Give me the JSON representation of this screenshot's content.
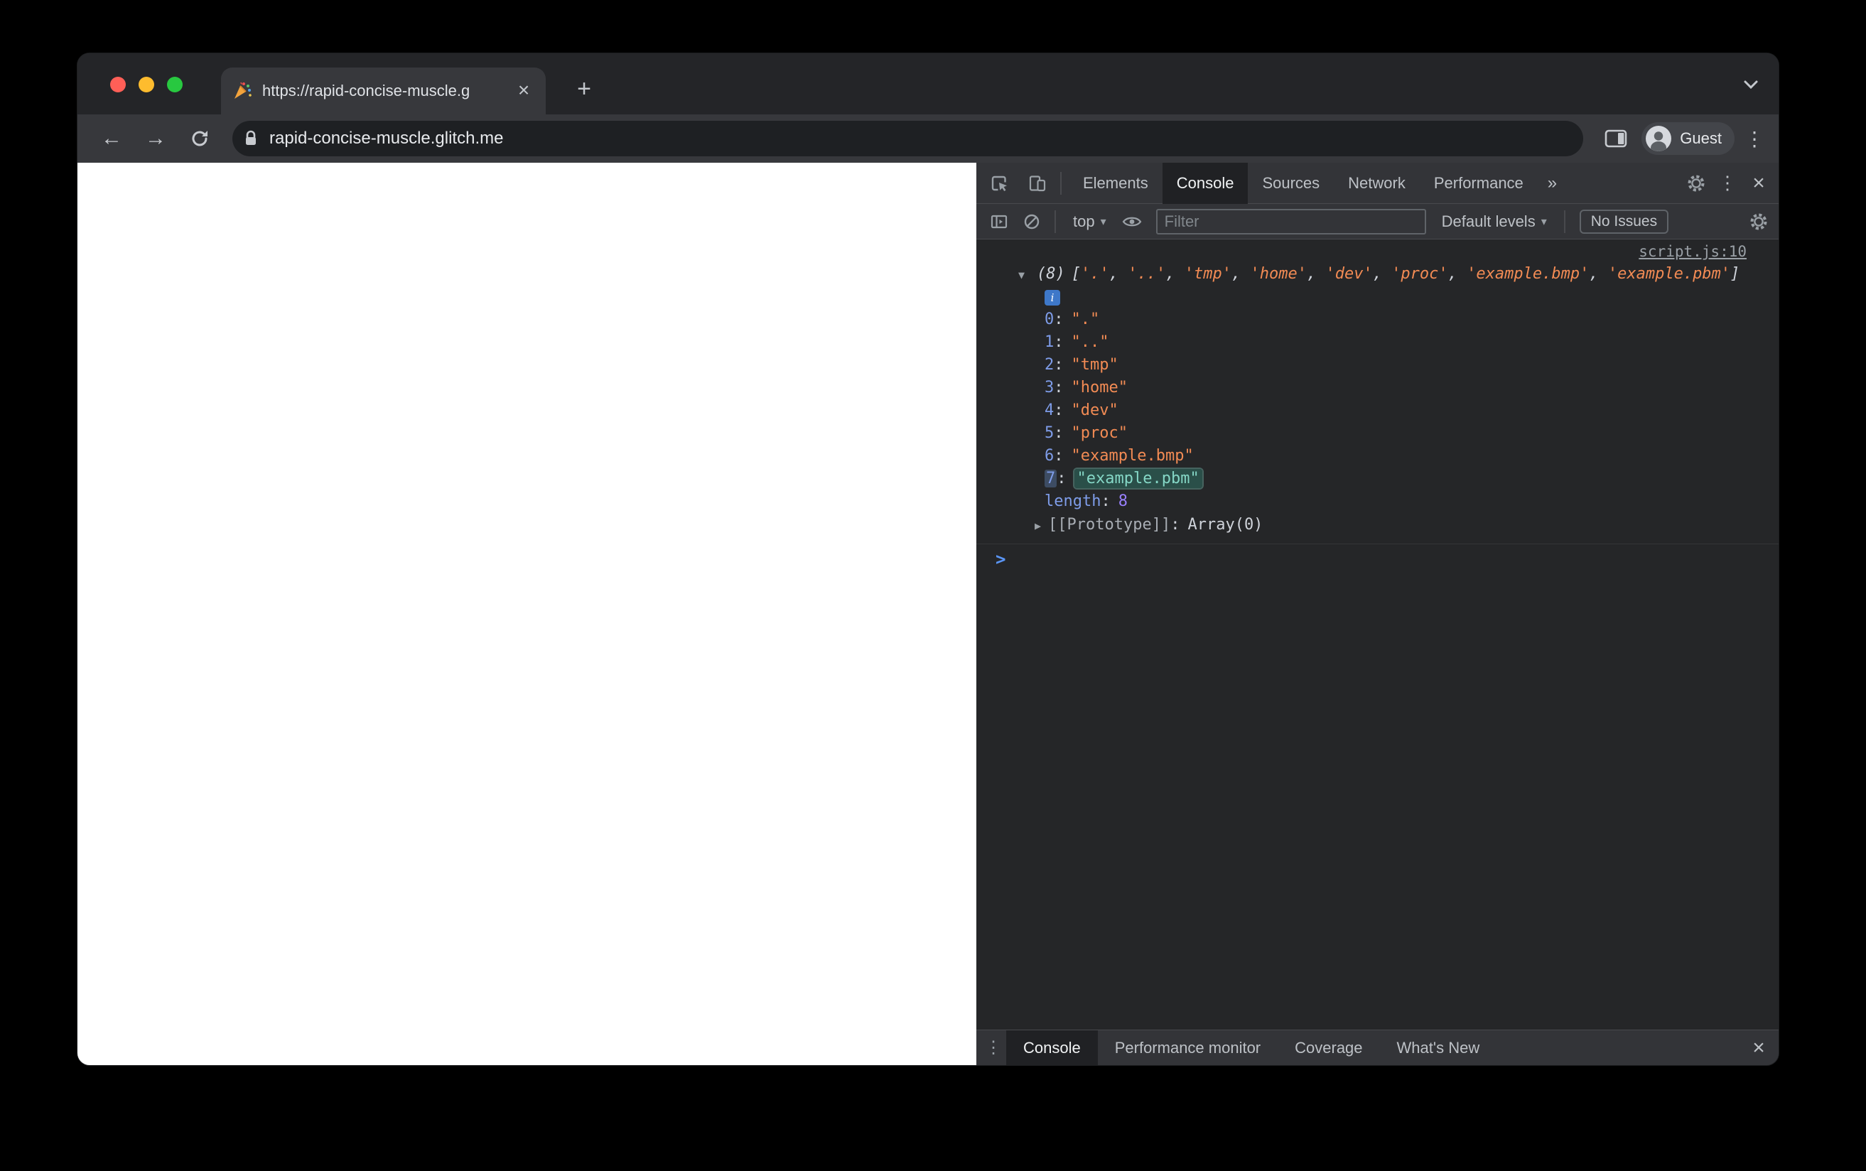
{
  "chrome": {
    "tab_title": "https://rapid-concise-muscle.g",
    "url": "rapid-concise-muscle.glitch.me",
    "profile_label": "Guest"
  },
  "devtools": {
    "tabs": {
      "elements": "Elements",
      "console": "Console",
      "sources": "Sources",
      "network": "Network",
      "performance": "Performance"
    },
    "toolbar": {
      "context_label": "top",
      "filter_placeholder": "Filter",
      "levels_label": "Default levels",
      "issues_label": "No Issues"
    },
    "console": {
      "source_link": "script.js:10",
      "count": "(8)",
      "bracket_open": "[",
      "bracket_close": "]",
      "item_sep": ", ",
      "preview_items": [
        "'.'",
        "'..'",
        "'tmp'",
        "'home'",
        "'dev'",
        "'proc'",
        "'example.bmp'",
        "'example.pbm'"
      ],
      "entries": [
        {
          "index": "0",
          "value": "\".\""
        },
        {
          "index": "1",
          "value": "\"..\""
        },
        {
          "index": "2",
          "value": "\"tmp\""
        },
        {
          "index": "3",
          "value": "\"home\""
        },
        {
          "index": "4",
          "value": "\"dev\""
        },
        {
          "index": "5",
          "value": "\"proc\""
        },
        {
          "index": "6",
          "value": "\"example.bmp\""
        },
        {
          "index": "7",
          "value": "\"example.pbm\""
        }
      ],
      "colon": ":",
      "length_label": "length",
      "length_value": "8",
      "prototype_label": "[[Prototype]]",
      "prototype_value": "Array(0)",
      "info_glyph": "i",
      "prompt_glyph": ">"
    },
    "drawer": {
      "console": "Console",
      "performance_monitor": "Performance monitor",
      "coverage": "Coverage",
      "whats_new": "What's New"
    }
  },
  "glyphs": {
    "close": "×",
    "plus": "+",
    "back_arrow": "←",
    "forward_arrow": "→",
    "kebab": "⋮",
    "more_chevrons": "»",
    "triangle_down": "▼",
    "triangle_right": "▶",
    "dropdown_arrow": "▾"
  },
  "icons": {
    "favicon": "party-popper-icon",
    "lock": "lock-icon",
    "reload": "reload-icon",
    "side_panel": "side-panel-icon",
    "avatar": "guest-avatar-icon",
    "inspect": "inspect-icon",
    "device": "device-toolbar-icon",
    "console_sidebar": "console-sidebar-icon",
    "clear_console": "clear-console-icon",
    "live_expression": "eye-icon",
    "settings": "gear-icon"
  }
}
